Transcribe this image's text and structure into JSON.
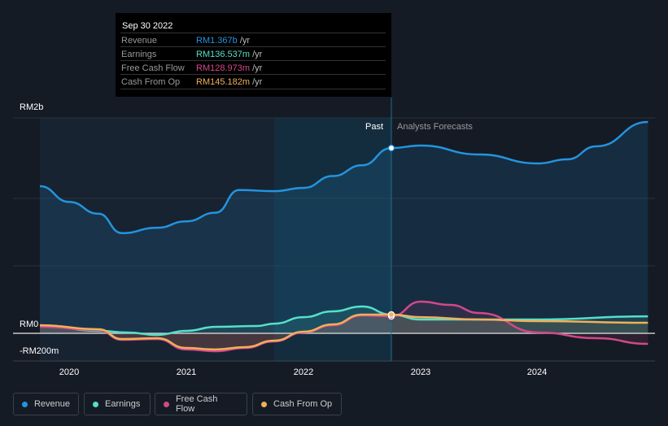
{
  "tooltip": {
    "date": "Sep 30 2022",
    "rows": [
      {
        "label": "Revenue",
        "value": "RM1.367b",
        "unit": "/yr",
        "color": "#2394df"
      },
      {
        "label": "Earnings",
        "value": "RM136.537m",
        "unit": "/yr",
        "color": "#55e0c8"
      },
      {
        "label": "Free Cash Flow",
        "value": "RM128.973m",
        "unit": "/yr",
        "color": "#d4478a"
      },
      {
        "label": "Cash From Op",
        "value": "RM145.182m",
        "unit": "/yr",
        "color": "#f0b05a"
      }
    ]
  },
  "chart_data": {
    "type": "line",
    "title": "",
    "xlabel": "",
    "ylabel": "",
    "y_unit": "RM millions",
    "ylim": [
      -200,
      2000
    ],
    "xlim": [
      2019.55,
      2024.95
    ],
    "y_ticks": [
      {
        "value": 2000,
        "label": "RM2b"
      },
      {
        "value": 0,
        "label": "RM0"
      },
      {
        "value": -200,
        "label": "-RM200m"
      }
    ],
    "x_ticks": [
      {
        "value": 2020,
        "label": "2020"
      },
      {
        "value": 2021,
        "label": "2021"
      },
      {
        "value": 2022,
        "label": "2022"
      },
      {
        "value": 2023,
        "label": "2023"
      },
      {
        "value": 2024,
        "label": "2024"
      }
    ],
    "divider": {
      "x": 2022.75,
      "past_label": "Past",
      "forecast_label": "Analysts Forecasts"
    },
    "series": [
      {
        "name": "Revenue",
        "color": "#2394df",
        "x": [
          2019.75,
          2020.0,
          2020.25,
          2020.45,
          2020.75,
          2021.0,
          2021.25,
          2021.45,
          2021.75,
          2022.0,
          2022.25,
          2022.5,
          2022.75,
          2023.0,
          2023.5,
          2024.0,
          2024.25,
          2024.5,
          2024.94
        ],
        "values": [
          1366,
          1220,
          1110,
          930,
          980,
          1040,
          1120,
          1330,
          1320,
          1350,
          1460,
          1560,
          1720,
          1743,
          1660,
          1577,
          1615,
          1736,
          1962
        ]
      },
      {
        "name": "Earnings",
        "color": "#55e0c8",
        "x": [
          2019.75,
          2020.25,
          2020.5,
          2020.75,
          2021.0,
          2021.25,
          2021.6,
          2021.75,
          2022.0,
          2022.25,
          2022.5,
          2022.75,
          2023.0,
          2023.5,
          2024.0,
          2024.94
        ],
        "values": [
          75,
          23,
          8,
          -15,
          23,
          60,
          68,
          90,
          150,
          204,
          249,
          174,
          128,
          128,
          128,
          158
        ]
      },
      {
        "name": "Free Cash Flow",
        "color": "#d4478a",
        "x": [
          2019.75,
          2020.25,
          2020.45,
          2020.75,
          2021.0,
          2021.25,
          2021.5,
          2021.75,
          2022.0,
          2022.25,
          2022.5,
          2022.75,
          2023.0,
          2023.25,
          2023.5,
          2024.0,
          2024.5,
          2024.94
        ],
        "values": [
          60,
          30,
          -60,
          -53,
          -150,
          -166,
          -136,
          -75,
          8,
          75,
          166,
          158,
          294,
          264,
          189,
          8,
          -45,
          -98
        ]
      },
      {
        "name": "Cash From Op",
        "color": "#f0b05a",
        "x": [
          2019.75,
          2020.25,
          2020.45,
          2020.75,
          2021.0,
          2021.25,
          2021.5,
          2021.75,
          2022.0,
          2022.25,
          2022.5,
          2022.75,
          2023.0,
          2023.5,
          2024.0,
          2024.94
        ],
        "values": [
          75,
          38,
          -53,
          -45,
          -136,
          -150,
          -128,
          -68,
          15,
          83,
          174,
          174,
          150,
          128,
          113,
          98
        ]
      }
    ],
    "legend_position": "bottom-left"
  }
}
